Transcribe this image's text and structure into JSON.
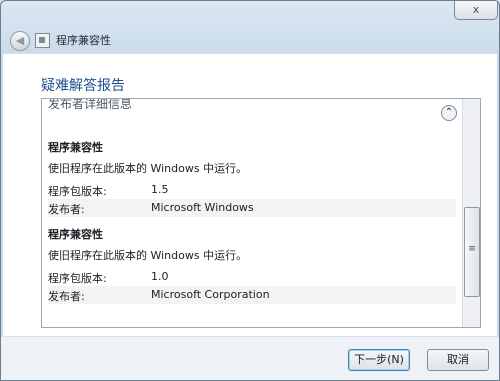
{
  "window": {
    "close_glyph": "x"
  },
  "nav": {
    "title": "程序兼容性",
    "back_glyph": "◀"
  },
  "content": {
    "heading": "疑难解答报告",
    "box_header": "发布者详细信息",
    "collapse_glyph": "⌃",
    "sections": [
      {
        "title": "程序兼容性",
        "description": "使旧程序在此版本的 Windows 中运行。",
        "version_label": "程序包版本:",
        "version_value": "1.5",
        "publisher_label": "发布者:",
        "publisher_value": "Microsoft Windows"
      },
      {
        "title": "程序兼容性",
        "description": "使旧程序在此版本的 Windows 中运行。",
        "version_label": "程序包版本:",
        "version_value": "1.0",
        "publisher_label": "发布者:",
        "publisher_value": "Microsoft Corporation"
      }
    ]
  },
  "footer": {
    "next_label": "下一步(N)",
    "cancel_label": "取消"
  }
}
